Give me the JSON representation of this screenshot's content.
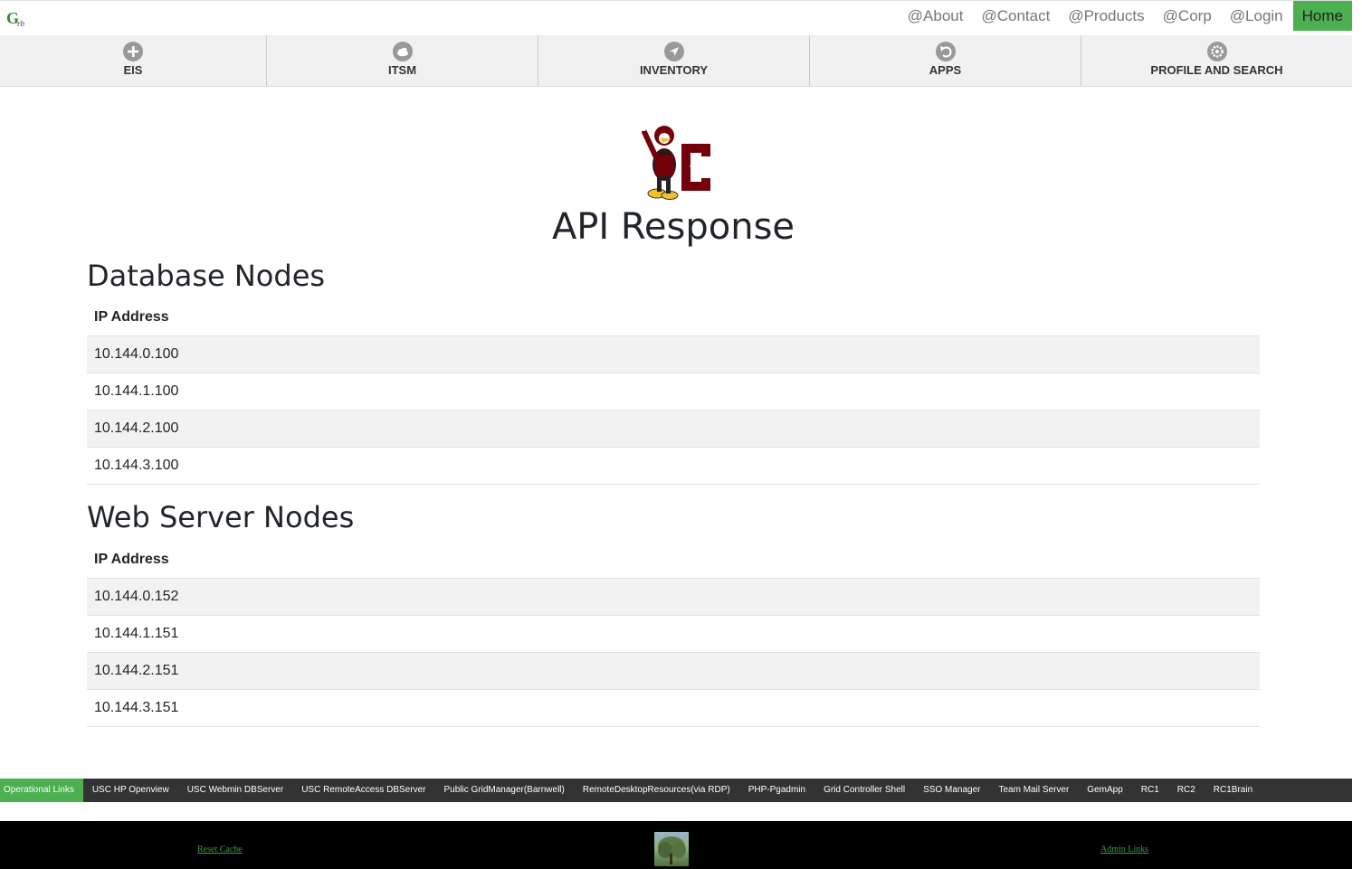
{
  "topnav": {
    "links": [
      "@About",
      "@Contact",
      "@Products",
      "@Corp",
      "@Login"
    ],
    "home": "Home"
  },
  "iconbar": {
    "items": [
      {
        "label": "EIS",
        "icon": "plus-circle-icon"
      },
      {
        "label": "ITSM",
        "icon": "cloud-icon"
      },
      {
        "label": "INVENTORY",
        "icon": "location-arrow-icon"
      },
      {
        "label": "APPS",
        "icon": "undo-icon"
      },
      {
        "label": "PROFILE AND SEARCH",
        "icon": "gear-icon"
      }
    ]
  },
  "main": {
    "title": "API Response",
    "database": {
      "heading": "Database Nodes",
      "column": "IP Address",
      "rows": [
        "10.144.0.100",
        "10.144.1.100",
        "10.144.2.100",
        "10.144.3.100"
      ]
    },
    "web": {
      "heading": "Web Server Nodes",
      "column": "IP Address",
      "rows": [
        "10.144.0.152",
        "10.144.1.151",
        "10.144.2.151",
        "10.144.3.151"
      ]
    }
  },
  "oplinks": [
    "Operational Links",
    "USC HP Openview",
    "USC Webmin DBServer",
    "USC RemoteAccess DBServer",
    "Public GridManager(Barnwell)",
    "RemoteDesktopResources(via RDP)",
    "PHP-Pgadmin",
    "Grid Controller Shell",
    "SSO Manager",
    "Team Mail Server",
    "GemApp",
    "RC1",
    "RC2",
    "RC1Brain"
  ],
  "footer": {
    "reset": "Reset Cache",
    "admin": "Admin Links"
  },
  "colors": {
    "accent": "#4caf50",
    "oplinks_bg": "#333333",
    "footer_bg": "#000000"
  }
}
